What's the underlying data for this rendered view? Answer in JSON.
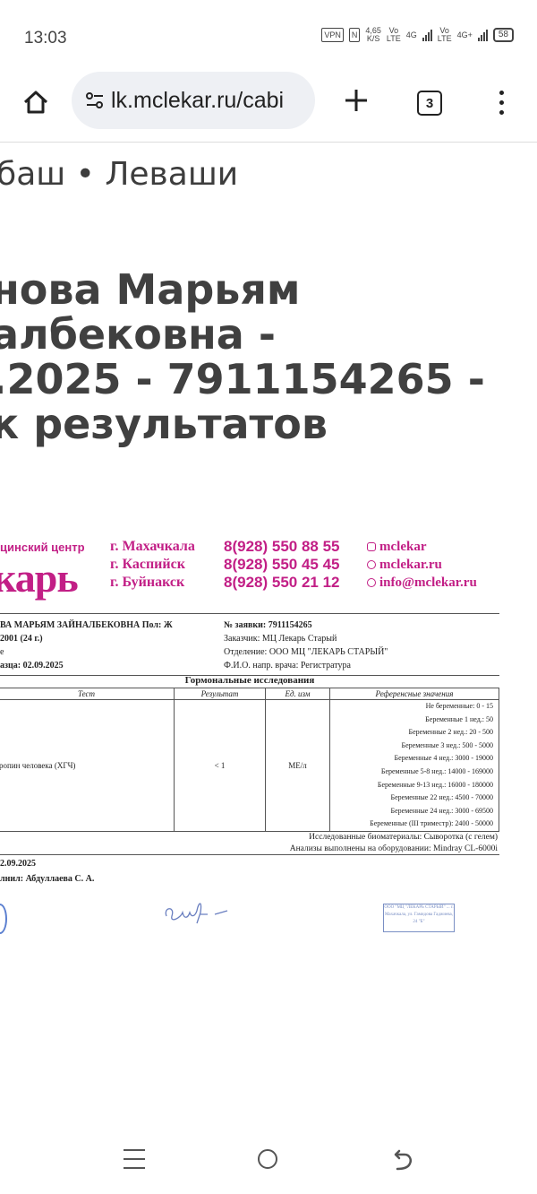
{
  "status_bar": {
    "time": "13:03",
    "vpn": "VPN",
    "nfc": "N",
    "speed_value": "4,65",
    "speed_unit": "K/S",
    "sim1_top": "Vo",
    "sim1_bottom": "LTE",
    "net1": "4G",
    "sim2_top": "Vo",
    "sim2_bottom": "LTE",
    "net2": "4G+",
    "battery": "58"
  },
  "browser": {
    "url": "lk.mclekar.ru/cabi",
    "tab_count": "3",
    "icons": [
      "home-icon",
      "site-settings-icon",
      "new-tab-icon",
      "tab-switcher-icon",
      "overflow-menu-icon"
    ]
  },
  "page": {
    "location": "баш • Леваши",
    "title_lines": [
      "нова Марьям",
      "албековна -",
      ".2025 - 7911154265 -",
      "к результатов"
    ]
  },
  "document": {
    "brand_small": "цинский центр",
    "brand_big": "карь",
    "cities": [
      "г. Махачкала",
      "г. Каспийск",
      "г. Буйнакск"
    ],
    "phones": [
      "8(928) 550 88 55",
      "8(928) 550 45 45",
      "8(928) 550 21 12"
    ],
    "contacts": [
      "mclekar",
      "mclekar.ru",
      "info@mclekar.ru"
    ],
    "patient_left": [
      "ВА МАРЬЯМ ЗАЙНАЛБЕКОВНА Пол: Ж",
      "2001 (24 г.)",
      "е",
      "азца: 02.09.2025"
    ],
    "patient_right": [
      "№ заявки: 7911154265",
      "Заказчик: МЦ Лекарь Старый",
      "Отделение: ООО МЦ \"ЛЕКАРЬ СТАРЫЙ\"",
      "Ф.И.О. напр. врача: Регистратура"
    ],
    "section_title": "Гормональные исследования",
    "table_headers": [
      "Тест",
      "Результат",
      "Ед. изм",
      "Референсные значения"
    ],
    "row": {
      "test": "ропин человека (ХГЧ)",
      "result": "< 1",
      "unit": "МЕ/л",
      "references": [
        "Не беременные: 0 - 15",
        "Беременные 1 нед.: 50",
        "Беременные 2 нед.: 20 - 500",
        "Беременные 3 нед.: 500 - 5000",
        "Беременные 4 нед.: 3000 - 19000",
        "Беременные 5-8 нед.: 14000 - 169000",
        "Беременные 9-13 нед.: 16000 - 180000",
        "Беременные 22 нед.: 4500 - 70000",
        "Беременные 24 нед.: 3000 - 69500",
        "Беременные (III триместр): 2400 - 50000"
      ]
    },
    "footer_right": [
      "Исследованные биоматериалы: Сыворотка (с гелем)",
      "Анализы выполнены на оборудовании: Mindray CL-6000i"
    ],
    "footer_left": [
      "2.09.2025",
      "лнил: Абдуллаева С. А."
    ],
    "stamp_text": "ООО \"МЦ \"ЛЕКАРЬ СТАРЫЙ\" ... г. Махачкала, ул. Гамидова Гаджиева, 24 \"Б\""
  },
  "colors": {
    "brand": "#c21f86",
    "url_pill": "#eef0f4",
    "title_text": "#404040"
  }
}
